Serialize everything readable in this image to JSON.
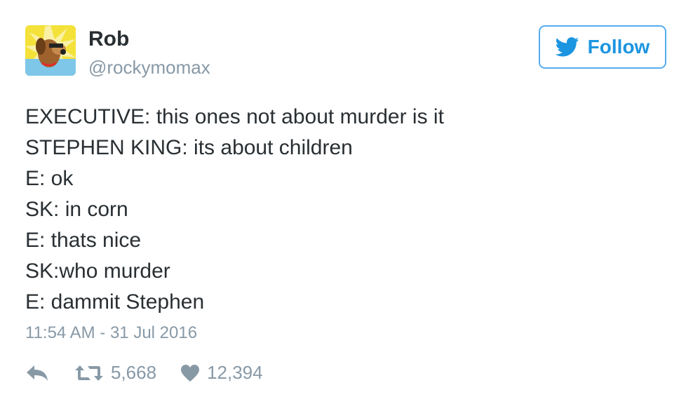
{
  "user": {
    "name": "Rob",
    "handle": "@rockymomax",
    "avatar_icon": "dog-avatar"
  },
  "follow_button": {
    "label": "Follow",
    "icon": "twitter-bird-icon",
    "color": "#1b95e0"
  },
  "tweet": {
    "lines": [
      "EXECUTIVE: this ones not about murder is it",
      "STEPHEN KING: its about children",
      "E: ok",
      "SK: in corn",
      "E: thats nice",
      "SK:who murder",
      "E: dammit Stephen"
    ],
    "timestamp": "11:54 AM - 31 Jul 2016"
  },
  "actions": {
    "reply_icon": "reply-icon",
    "retweet_icon": "retweet-icon",
    "retweet_count": "5,668",
    "like_icon": "heart-icon",
    "like_count": "12,394"
  }
}
